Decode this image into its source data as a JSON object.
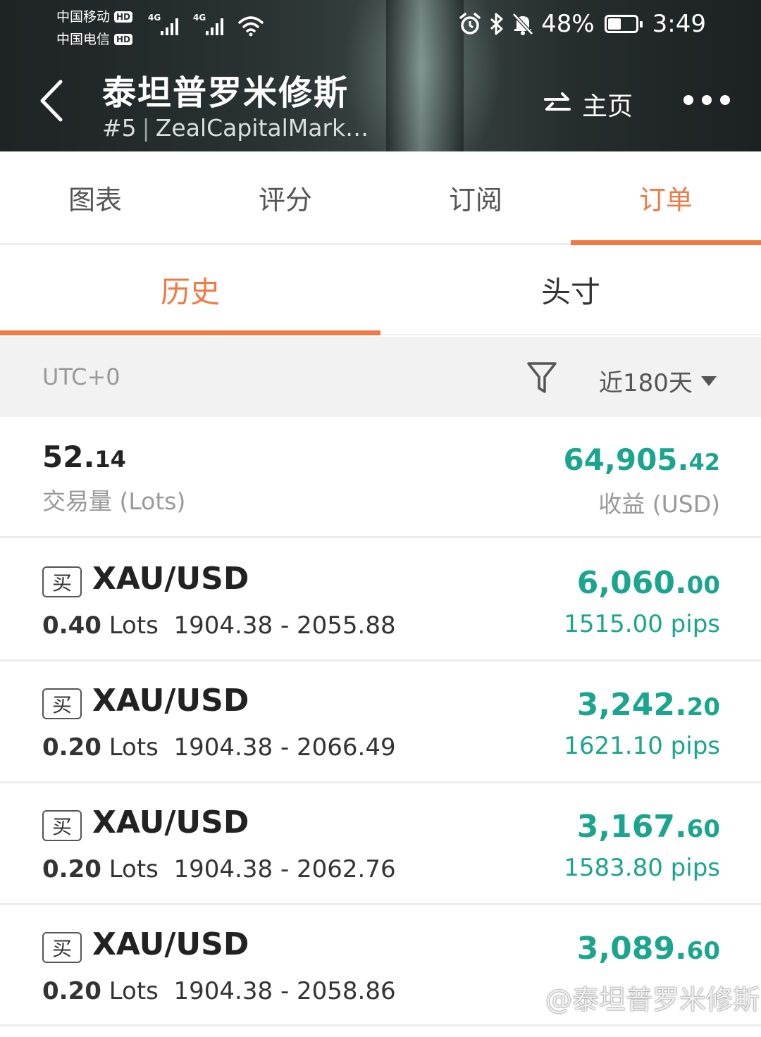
{
  "status_bar": {
    "carrier1": "中国移动",
    "carrier2": "中国电信",
    "hd": "HD",
    "net1": "4G",
    "net2": "4G",
    "battery": "48%",
    "battery_level": 0.48,
    "time": "3:49"
  },
  "header": {
    "title": "泰坦普罗米修斯",
    "rank": "#5",
    "subtitle_company": "ZealCapitalMark…",
    "home_label": "主页"
  },
  "tabs": [
    "图表",
    "评分",
    "订阅",
    "订单"
  ],
  "subtabs": [
    "历史",
    "头寸"
  ],
  "filter": {
    "timezone": "UTC+0",
    "period": "近180天"
  },
  "summary": {
    "volume_int": "52.",
    "volume_dec": "14",
    "volume_label": "交易量 (Lots)",
    "profit_int": "64,905.",
    "profit_dec": "42",
    "profit_label": "收益 (USD)"
  },
  "orders": [
    {
      "type": "买",
      "symbol": "XAU/USD",
      "lots": "0.40",
      "lots_unit": "Lots",
      "range": "1904.38 - 2055.88",
      "profit_int": "6,060.",
      "profit_dec": "00",
      "pips": "1515.00 pips"
    },
    {
      "type": "买",
      "symbol": "XAU/USD",
      "lots": "0.20",
      "lots_unit": "Lots",
      "range": "1904.38 - 2066.49",
      "profit_int": "3,242.",
      "profit_dec": "20",
      "pips": "1621.10 pips"
    },
    {
      "type": "买",
      "symbol": "XAU/USD",
      "lots": "0.20",
      "lots_unit": "Lots",
      "range": "1904.38 - 2062.76",
      "profit_int": "3,167.",
      "profit_dec": "60",
      "pips": "1583.80 pips"
    },
    {
      "type": "买",
      "symbol": "XAU/USD",
      "lots": "0.20",
      "lots_unit": "Lots",
      "range": "1904.38 - 2058.86",
      "profit_int": "3,089.",
      "profit_dec": "60",
      "pips": ""
    }
  ],
  "watermark": "@泰坦普罗米修斯",
  "colors": {
    "accent": "#ef7a45",
    "profit_green": "#1ba58e"
  }
}
